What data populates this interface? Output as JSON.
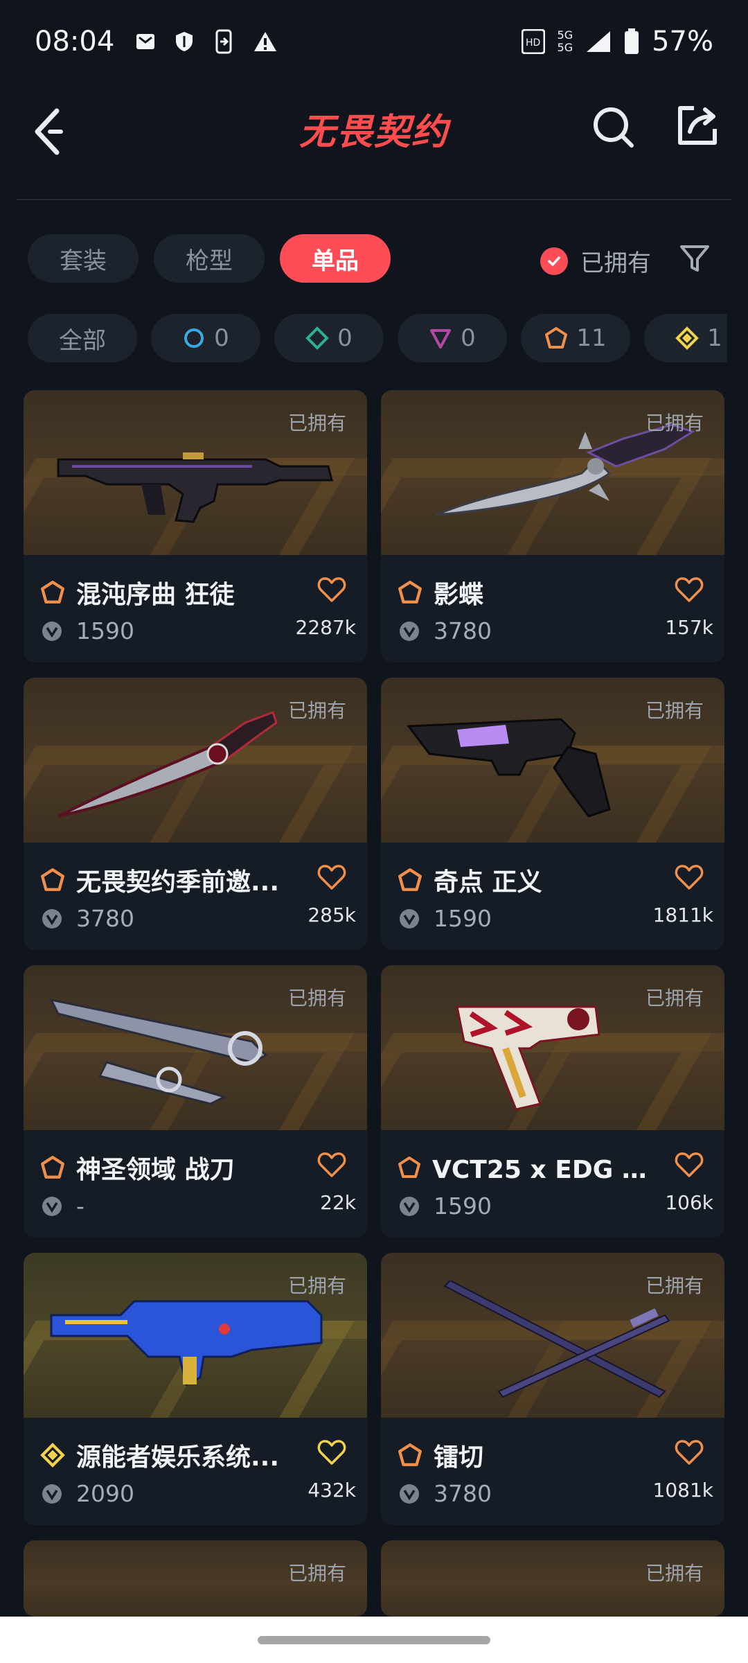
{
  "status_bar": {
    "time": "08:04",
    "network": "5G",
    "battery": "57%"
  },
  "header": {
    "title": "无畏契约"
  },
  "tabs": [
    {
      "label": "套装",
      "active": false
    },
    {
      "label": "枪型",
      "active": false
    },
    {
      "label": "单品",
      "active": true
    }
  ],
  "owned_filter": {
    "label": "已拥有",
    "checked": true
  },
  "tiers": [
    {
      "label": "全部",
      "icon": "",
      "color": ""
    },
    {
      "label": "0",
      "icon": "select-tier-icon",
      "color": "#3aa7e6"
    },
    {
      "label": "0",
      "icon": "deluxe-tier-icon",
      "color": "#2fae95"
    },
    {
      "label": "0",
      "icon": "premium-tier-icon",
      "color": "#b04aa3"
    },
    {
      "label": "11",
      "icon": "exclusive-tier-icon",
      "color": "#f0904a"
    },
    {
      "label": "1",
      "icon": "ultra-tier-icon",
      "color": "#f2d34b"
    }
  ],
  "items": [
    {
      "name": "混沌序曲 狂徒",
      "price": "1590",
      "count": "2287k",
      "owned": "已拥有",
      "tier_color": "#f0904a",
      "weapon": "rifle"
    },
    {
      "name": "影蝶",
      "price": "3780",
      "count": "157k",
      "owned": "已拥有",
      "tier_color": "#f0904a",
      "weapon": "butterfly-knife"
    },
    {
      "name": "无畏契约季前邀...",
      "price": "3780",
      "count": "285k",
      "owned": "已拥有",
      "tier_color": "#f0904a",
      "weapon": "dagger"
    },
    {
      "name": "奇点 正义",
      "price": "1590",
      "count": "1811k",
      "owned": "已拥有",
      "tier_color": "#f0904a",
      "weapon": "revolver"
    },
    {
      "name": "神圣领域 战刀",
      "price": "-",
      "count": "22k",
      "owned": "已拥有",
      "tier_color": "#f0904a",
      "weapon": "blades"
    },
    {
      "name": "VCT25 x EDG 标...",
      "price": "1590",
      "count": "106k",
      "owned": "已拥有",
      "tier_color": "#f0904a",
      "weapon": "pistol"
    },
    {
      "name": "源能者娱乐系统...",
      "price": "2090",
      "count": "432k",
      "owned": "已拥有",
      "tier_color": "#f2d34b",
      "weapon": "blue-rifle"
    },
    {
      "name": "镭切",
      "price": "3780",
      "count": "1081k",
      "owned": "已拥有",
      "tier_color": "#f0904a",
      "weapon": "katana"
    },
    {
      "name": "",
      "price": "",
      "count": "",
      "owned": "已拥有",
      "tier_color": "#f0904a",
      "weapon": ""
    },
    {
      "name": "",
      "price": "",
      "count": "",
      "owned": "已拥有",
      "tier_color": "#f0904a",
      "weapon": ""
    }
  ]
}
